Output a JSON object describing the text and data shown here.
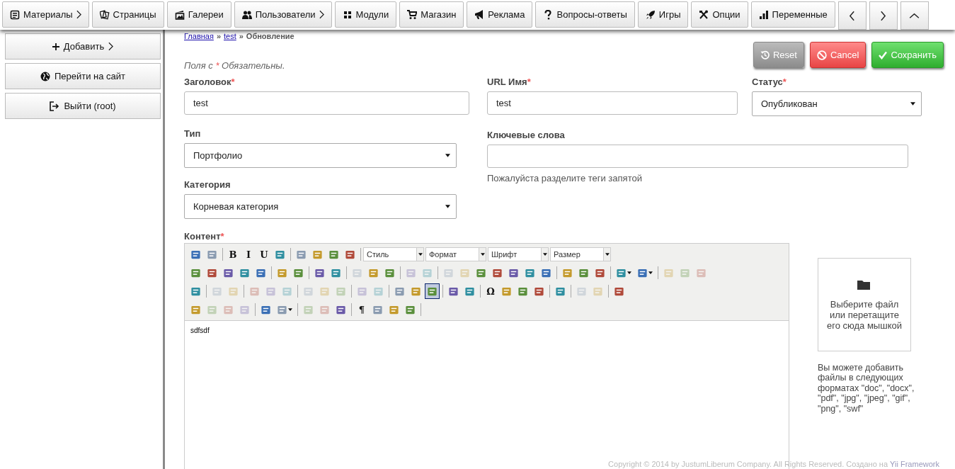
{
  "nav": {
    "items": [
      {
        "label": "Материалы",
        "has_submenu": true
      },
      {
        "label": "Страницы",
        "has_submenu": false
      },
      {
        "label": "Галереи",
        "has_submenu": false
      },
      {
        "label": "Пользователи",
        "has_submenu": true
      },
      {
        "label": "Модули",
        "has_submenu": false
      },
      {
        "label": "Магазин",
        "has_submenu": false
      },
      {
        "label": "Реклама",
        "has_submenu": false
      },
      {
        "label": "Вопросы-ответы",
        "has_submenu": false
      },
      {
        "label": "Игры",
        "has_submenu": false
      },
      {
        "label": "Опции",
        "has_submenu": false
      },
      {
        "label": "Переменные",
        "has_submenu": false
      }
    ]
  },
  "sidebar": {
    "items": [
      {
        "label": "Добавить",
        "has_submenu": true
      },
      {
        "label": "Перейти на сайт",
        "has_submenu": false
      },
      {
        "label": "Выйти (root)",
        "has_submenu": false
      }
    ]
  },
  "breadcrumb": {
    "links": [
      "Главная",
      "test"
    ],
    "separator": "»",
    "current": "Обновление"
  },
  "required_note": {
    "before": "Поля с",
    "mark": "*",
    "after": "Обязательны."
  },
  "actions": [
    {
      "label": "Reset",
      "kind": "reset"
    },
    {
      "label": "Cancel",
      "kind": "cancel"
    },
    {
      "label": "Сохранить",
      "kind": "save"
    }
  ],
  "fields": {
    "title": {
      "label": "Заголовок",
      "required": true,
      "value": "test"
    },
    "url_name": {
      "label": "URL Имя",
      "required": true,
      "value": "test"
    },
    "status": {
      "label": "Статус",
      "required": true,
      "value": "Опубликован"
    },
    "type": {
      "label": "Тип",
      "required": false,
      "value": "Портфолио"
    },
    "keywords": {
      "label": "Ключевые слова",
      "required": false,
      "hint": "Пожалуйста разделите теги запятой"
    },
    "category": {
      "label": "Категория",
      "required": false,
      "value": "Корневая категория"
    }
  },
  "content": {
    "label": "Контент",
    "required": true,
    "text": "sdfsdf",
    "toolbar_rows": [
      [
        {
          "kind": "icon",
          "disabled": false,
          "on": false
        },
        {
          "kind": "icon",
          "disabled": false,
          "on": false
        },
        {
          "kind": "sep"
        },
        {
          "kind": "glyph",
          "text": "B",
          "disabled": false
        },
        {
          "kind": "glyph",
          "text": "I",
          "disabled": false
        },
        {
          "kind": "glyph",
          "text": "U",
          "disabled": false
        },
        {
          "kind": "icon",
          "disabled": false,
          "on": false
        },
        {
          "kind": "sep"
        },
        {
          "kind": "icon",
          "disabled": false,
          "on": false
        },
        {
          "kind": "icon",
          "disabled": false,
          "on": false
        },
        {
          "kind": "icon",
          "disabled": false,
          "on": false
        },
        {
          "kind": "icon",
          "disabled": false,
          "on": false
        },
        {
          "kind": "sep"
        },
        {
          "kind": "select",
          "label": "Стиль"
        },
        {
          "kind": "select",
          "label": "Формат"
        },
        {
          "kind": "select",
          "label": "Шрифт"
        },
        {
          "kind": "select",
          "label": "Размер"
        }
      ],
      [
        {
          "kind": "icon",
          "disabled": false,
          "on": false
        },
        {
          "kind": "icon",
          "disabled": false,
          "on": false
        },
        {
          "kind": "icon",
          "disabled": false,
          "on": false
        },
        {
          "kind": "icon",
          "disabled": false,
          "on": false
        },
        {
          "kind": "icon",
          "disabled": false,
          "on": false
        },
        {
          "kind": "sep"
        },
        {
          "kind": "icon",
          "disabled": false,
          "on": false
        },
        {
          "kind": "icon",
          "disabled": false,
          "on": false
        },
        {
          "kind": "sep"
        },
        {
          "kind": "icon",
          "disabled": false,
          "on": false
        },
        {
          "kind": "icon",
          "disabled": false,
          "on": false
        },
        {
          "kind": "sep"
        },
        {
          "kind": "icon",
          "disabled": true,
          "on": false
        },
        {
          "kind": "icon",
          "disabled": false,
          "on": false
        },
        {
          "kind": "icon",
          "disabled": false,
          "on": false
        },
        {
          "kind": "sep"
        },
        {
          "kind": "icon",
          "disabled": true,
          "on": false
        },
        {
          "kind": "icon",
          "disabled": true,
          "on": false
        },
        {
          "kind": "sep"
        },
        {
          "kind": "icon",
          "disabled": true,
          "on": false
        },
        {
          "kind": "icon",
          "disabled": true,
          "on": false
        },
        {
          "kind": "icon",
          "disabled": false,
          "on": false
        },
        {
          "kind": "icon",
          "disabled": false,
          "on": false
        },
        {
          "kind": "icon",
          "disabled": false,
          "on": false
        },
        {
          "kind": "icon",
          "disabled": false,
          "on": false
        },
        {
          "kind": "icon",
          "disabled": false,
          "on": false
        },
        {
          "kind": "sep"
        },
        {
          "kind": "icon",
          "disabled": false,
          "on": false
        },
        {
          "kind": "icon",
          "disabled": false,
          "on": false
        },
        {
          "kind": "icon",
          "disabled": false,
          "on": false
        },
        {
          "kind": "sep"
        },
        {
          "kind": "menu-icon",
          "disabled": false,
          "on": false
        },
        {
          "kind": "menu-icon",
          "disabled": false,
          "on": false
        },
        {
          "kind": "sep"
        },
        {
          "kind": "icon",
          "disabled": true,
          "on": false
        },
        {
          "kind": "icon",
          "disabled": true,
          "on": false
        },
        {
          "kind": "icon",
          "disabled": true,
          "on": false
        }
      ],
      [
        {
          "kind": "icon",
          "disabled": false,
          "on": false
        },
        {
          "kind": "sep"
        },
        {
          "kind": "icon",
          "disabled": true,
          "on": false
        },
        {
          "kind": "icon",
          "disabled": true,
          "on": false
        },
        {
          "kind": "sep"
        },
        {
          "kind": "icon",
          "disabled": true,
          "on": false
        },
        {
          "kind": "icon",
          "disabled": true,
          "on": false
        },
        {
          "kind": "icon",
          "disabled": true,
          "on": false
        },
        {
          "kind": "sep"
        },
        {
          "kind": "icon",
          "disabled": true,
          "on": false
        },
        {
          "kind": "icon",
          "disabled": true,
          "on": false
        },
        {
          "kind": "icon",
          "disabled": true,
          "on": false
        },
        {
          "kind": "sep"
        },
        {
          "kind": "icon",
          "disabled": true,
          "on": false
        },
        {
          "kind": "icon",
          "disabled": true,
          "on": false
        },
        {
          "kind": "sep"
        },
        {
          "kind": "icon",
          "disabled": false,
          "on": false
        },
        {
          "kind": "icon",
          "disabled": false,
          "on": false
        },
        {
          "kind": "icon",
          "disabled": false,
          "on": true
        },
        {
          "kind": "sep"
        },
        {
          "kind": "icon",
          "disabled": false,
          "on": false
        },
        {
          "kind": "icon",
          "disabled": false,
          "on": false
        },
        {
          "kind": "sep"
        },
        {
          "kind": "glyph",
          "text": "Ω",
          "disabled": false
        },
        {
          "kind": "icon",
          "disabled": false,
          "on": false
        },
        {
          "kind": "icon",
          "disabled": false,
          "on": false
        },
        {
          "kind": "icon",
          "disabled": false,
          "on": false
        },
        {
          "kind": "sep"
        },
        {
          "kind": "icon",
          "disabled": false,
          "on": false
        },
        {
          "kind": "sep"
        },
        {
          "kind": "icon",
          "disabled": true,
          "on": false
        },
        {
          "kind": "icon",
          "disabled": true,
          "on": false
        },
        {
          "kind": "sep"
        },
        {
          "kind": "icon",
          "disabled": false,
          "on": false
        }
      ],
      [
        {
          "kind": "icon",
          "disabled": false,
          "on": false
        },
        {
          "kind": "icon",
          "disabled": true,
          "on": false
        },
        {
          "kind": "icon",
          "disabled": true,
          "on": false
        },
        {
          "kind": "icon",
          "disabled": true,
          "on": false
        },
        {
          "kind": "sep"
        },
        {
          "kind": "icon",
          "disabled": false,
          "on": false
        },
        {
          "kind": "menu-icon",
          "disabled": false,
          "on": false
        },
        {
          "kind": "sep"
        },
        {
          "kind": "icon",
          "disabled": true,
          "on": false
        },
        {
          "kind": "icon",
          "disabled": true,
          "on": false
        },
        {
          "kind": "icon",
          "disabled": false,
          "on": false
        },
        {
          "kind": "sep"
        },
        {
          "kind": "glyph",
          "text": "¶",
          "disabled": false
        },
        {
          "kind": "icon",
          "disabled": false,
          "on": false
        },
        {
          "kind": "icon",
          "disabled": false,
          "on": false
        },
        {
          "kind": "icon",
          "disabled": false,
          "on": false
        },
        {
          "kind": "sep"
        }
      ]
    ]
  },
  "upload": {
    "prompt": "Выберите файл или перетащите его сюда мышкой",
    "formats_note": "Вы можете добавить файлы в следующих форматах \"doc\", \"docx\", \"pdf\", \"jpg\", \"jpeg\", \"gif\", \"png\", \"swf\""
  },
  "footer": {
    "text": "Copyright © 2014 by JustumLiberum Company. All Rights Reserved. Создано на",
    "link": "Yii Framework"
  }
}
